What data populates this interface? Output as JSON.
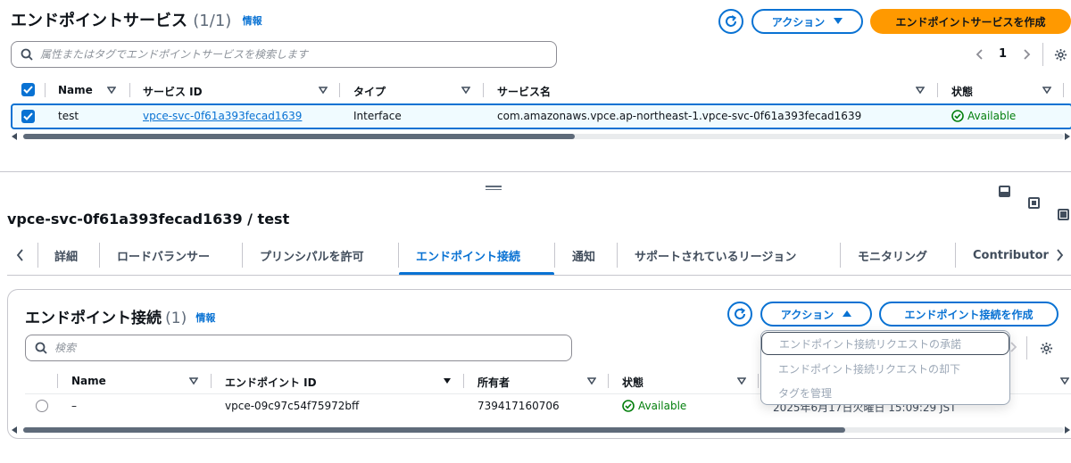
{
  "top": {
    "title": "エンドポイントサービス",
    "count": "(1/1)",
    "info": "情報",
    "actions_label": "アクション",
    "create_label": "エンドポイントサービスを作成",
    "search_placeholder": "属性またはタグでエンドポイントサービスを検索します",
    "page": "1",
    "columns": [
      "Name",
      "サービス ID",
      "タイプ",
      "サービス名",
      "状態"
    ],
    "rows": [
      {
        "name": "test",
        "service_id": "vpce-svc-0f61a393fecad1639",
        "type": "Interface",
        "service_name": "com.amazonaws.vpce.ap-northeast-1.vpce-svc-0f61a393fecad1639",
        "status": "Available",
        "selected": true
      }
    ],
    "scroll_fraction": 0.53
  },
  "panel": {
    "title": "vpce-svc-0f61a393fecad1639 / test",
    "tabs": [
      "詳細",
      "ロードバランサー",
      "プリンシパルを許可",
      "エンドポイント接続",
      "通知",
      "サポートされているリージョン",
      "モニタリング",
      "Contributor"
    ],
    "active_tab": "エンドポイント接続"
  },
  "connections": {
    "title": "エンドポイント接続",
    "count": "(1)",
    "info": "情報",
    "actions_label": "アクション",
    "create_label": "エンドポイント接続を作成",
    "search_placeholder": "検索",
    "columns": [
      "Name",
      "エンドポイント ID",
      "所有者",
      "状態"
    ],
    "rows": [
      {
        "name": "–",
        "endpoint_id": "vpce-09c97c54f75972bff",
        "owner": "739417160706",
        "status": "Available",
        "hidden_date": "2025年6月17日火曜日 15:09:29 JST"
      }
    ],
    "menu_items": [
      "エンドポイント接続リクエストの承諾",
      "エンドポイント接続リクエストの却下",
      "タグを管理"
    ],
    "scroll_fraction": 0.79
  },
  "colors": {
    "accent": "#0972d3",
    "primary_button": "#ff9900",
    "success": "#037f0c",
    "disabled_text": "#9ba7b6"
  }
}
